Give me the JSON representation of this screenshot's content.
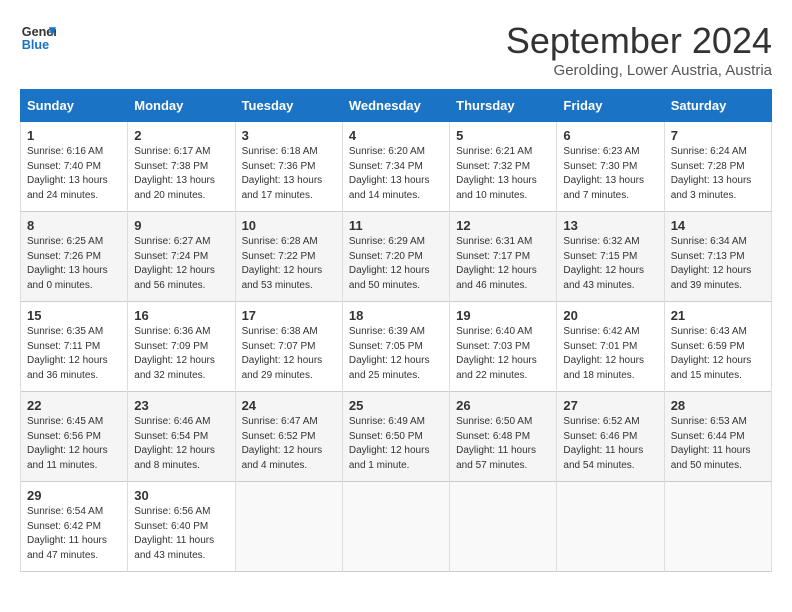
{
  "header": {
    "logo_line1": "General",
    "logo_line2": "Blue",
    "month": "September 2024",
    "location": "Gerolding, Lower Austria, Austria"
  },
  "days_of_week": [
    "Sunday",
    "Monday",
    "Tuesday",
    "Wednesday",
    "Thursday",
    "Friday",
    "Saturday"
  ],
  "weeks": [
    [
      {
        "day": "1",
        "sunrise": "6:16 AM",
        "sunset": "7:40 PM",
        "daylight": "13 hours and 24 minutes."
      },
      {
        "day": "2",
        "sunrise": "6:17 AM",
        "sunset": "7:38 PM",
        "daylight": "13 hours and 20 minutes."
      },
      {
        "day": "3",
        "sunrise": "6:18 AM",
        "sunset": "7:36 PM",
        "daylight": "13 hours and 17 minutes."
      },
      {
        "day": "4",
        "sunrise": "6:20 AM",
        "sunset": "7:34 PM",
        "daylight": "13 hours and 14 minutes."
      },
      {
        "day": "5",
        "sunrise": "6:21 AM",
        "sunset": "7:32 PM",
        "daylight": "13 hours and 10 minutes."
      },
      {
        "day": "6",
        "sunrise": "6:23 AM",
        "sunset": "7:30 PM",
        "daylight": "13 hours and 7 minutes."
      },
      {
        "day": "7",
        "sunrise": "6:24 AM",
        "sunset": "7:28 PM",
        "daylight": "13 hours and 3 minutes."
      }
    ],
    [
      {
        "day": "8",
        "sunrise": "6:25 AM",
        "sunset": "7:26 PM",
        "daylight": "13 hours and 0 minutes."
      },
      {
        "day": "9",
        "sunrise": "6:27 AM",
        "sunset": "7:24 PM",
        "daylight": "12 hours and 56 minutes."
      },
      {
        "day": "10",
        "sunrise": "6:28 AM",
        "sunset": "7:22 PM",
        "daylight": "12 hours and 53 minutes."
      },
      {
        "day": "11",
        "sunrise": "6:29 AM",
        "sunset": "7:20 PM",
        "daylight": "12 hours and 50 minutes."
      },
      {
        "day": "12",
        "sunrise": "6:31 AM",
        "sunset": "7:17 PM",
        "daylight": "12 hours and 46 minutes."
      },
      {
        "day": "13",
        "sunrise": "6:32 AM",
        "sunset": "7:15 PM",
        "daylight": "12 hours and 43 minutes."
      },
      {
        "day": "14",
        "sunrise": "6:34 AM",
        "sunset": "7:13 PM",
        "daylight": "12 hours and 39 minutes."
      }
    ],
    [
      {
        "day": "15",
        "sunrise": "6:35 AM",
        "sunset": "7:11 PM",
        "daylight": "12 hours and 36 minutes."
      },
      {
        "day": "16",
        "sunrise": "6:36 AM",
        "sunset": "7:09 PM",
        "daylight": "12 hours and 32 minutes."
      },
      {
        "day": "17",
        "sunrise": "6:38 AM",
        "sunset": "7:07 PM",
        "daylight": "12 hours and 29 minutes."
      },
      {
        "day": "18",
        "sunrise": "6:39 AM",
        "sunset": "7:05 PM",
        "daylight": "12 hours and 25 minutes."
      },
      {
        "day": "19",
        "sunrise": "6:40 AM",
        "sunset": "7:03 PM",
        "daylight": "12 hours and 22 minutes."
      },
      {
        "day": "20",
        "sunrise": "6:42 AM",
        "sunset": "7:01 PM",
        "daylight": "12 hours and 18 minutes."
      },
      {
        "day": "21",
        "sunrise": "6:43 AM",
        "sunset": "6:59 PM",
        "daylight": "12 hours and 15 minutes."
      }
    ],
    [
      {
        "day": "22",
        "sunrise": "6:45 AM",
        "sunset": "6:56 PM",
        "daylight": "12 hours and 11 minutes."
      },
      {
        "day": "23",
        "sunrise": "6:46 AM",
        "sunset": "6:54 PM",
        "daylight": "12 hours and 8 minutes."
      },
      {
        "day": "24",
        "sunrise": "6:47 AM",
        "sunset": "6:52 PM",
        "daylight": "12 hours and 4 minutes."
      },
      {
        "day": "25",
        "sunrise": "6:49 AM",
        "sunset": "6:50 PM",
        "daylight": "12 hours and 1 minute."
      },
      {
        "day": "26",
        "sunrise": "6:50 AM",
        "sunset": "6:48 PM",
        "daylight": "11 hours and 57 minutes."
      },
      {
        "day": "27",
        "sunrise": "6:52 AM",
        "sunset": "6:46 PM",
        "daylight": "11 hours and 54 minutes."
      },
      {
        "day": "28",
        "sunrise": "6:53 AM",
        "sunset": "6:44 PM",
        "daylight": "11 hours and 50 minutes."
      }
    ],
    [
      {
        "day": "29",
        "sunrise": "6:54 AM",
        "sunset": "6:42 PM",
        "daylight": "11 hours and 47 minutes."
      },
      {
        "day": "30",
        "sunrise": "6:56 AM",
        "sunset": "6:40 PM",
        "daylight": "11 hours and 43 minutes."
      },
      null,
      null,
      null,
      null,
      null
    ]
  ]
}
